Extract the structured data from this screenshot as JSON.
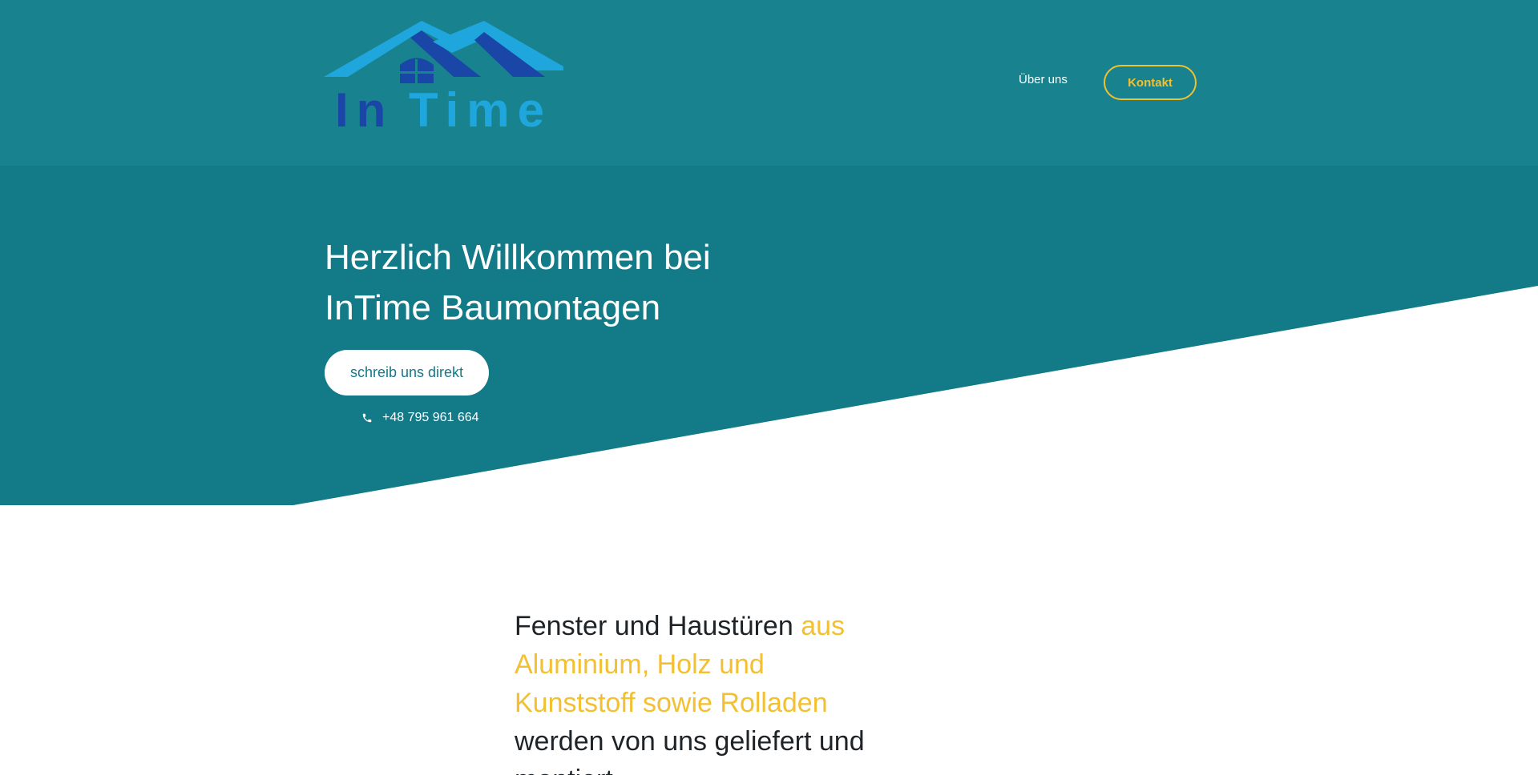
{
  "colors": {
    "header_bg": "#18838f",
    "hero_bg": "#137a88",
    "accent": "#f2c030",
    "logo_dark_blue": "#1a46a8",
    "logo_light_blue": "#1ea6dd",
    "text_dark": "#1e2328"
  },
  "header": {
    "logo_text": "InTime",
    "nav": {
      "about_label": "Über uns",
      "contact_label": "Kontakt"
    }
  },
  "hero": {
    "title_line1": "Herzlich Willkommen bei",
    "title_line2": "InTime Baumontagen",
    "cta_label": "schreib uns direkt",
    "phone_icon": "phone-icon",
    "phone_number": "+48 795 961 664"
  },
  "intro": {
    "text_part1": "Fenster und Haustüren ",
    "text_accent": "aus Aluminium, Holz und Kunststoff sowie Rolladen",
    "text_part2": " werden von uns geliefert und montiert."
  }
}
